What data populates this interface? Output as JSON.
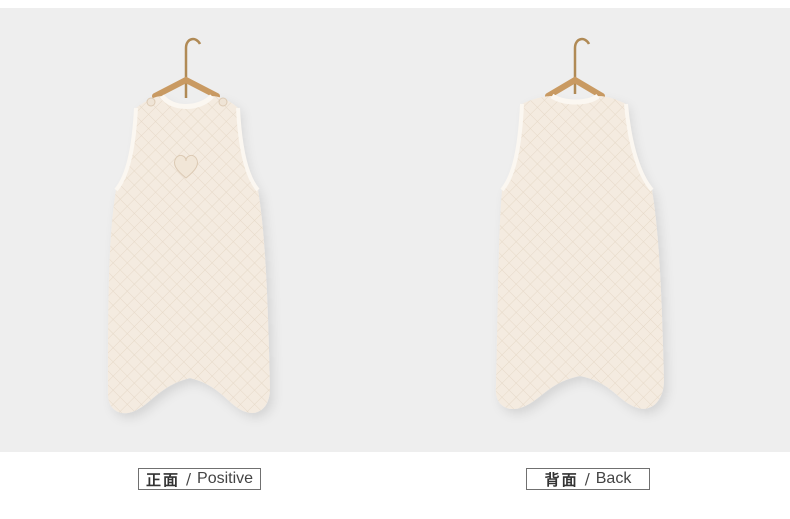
{
  "labels": {
    "front": {
      "cn": "正面",
      "sep": "/",
      "en": "Positive"
    },
    "back": {
      "cn": "背面",
      "sep": "/",
      "en": "Back"
    }
  },
  "colors": {
    "background": "#eeeeee",
    "fabric": "#f4ebe0",
    "trim": "#fbf7f1",
    "hanger_wood": "#c99a62",
    "hanger_hook": "#b08a55",
    "label_border": "#707070"
  },
  "images": {
    "front_view": "sleeping-bag-front",
    "back_view": "sleeping-bag-back"
  }
}
